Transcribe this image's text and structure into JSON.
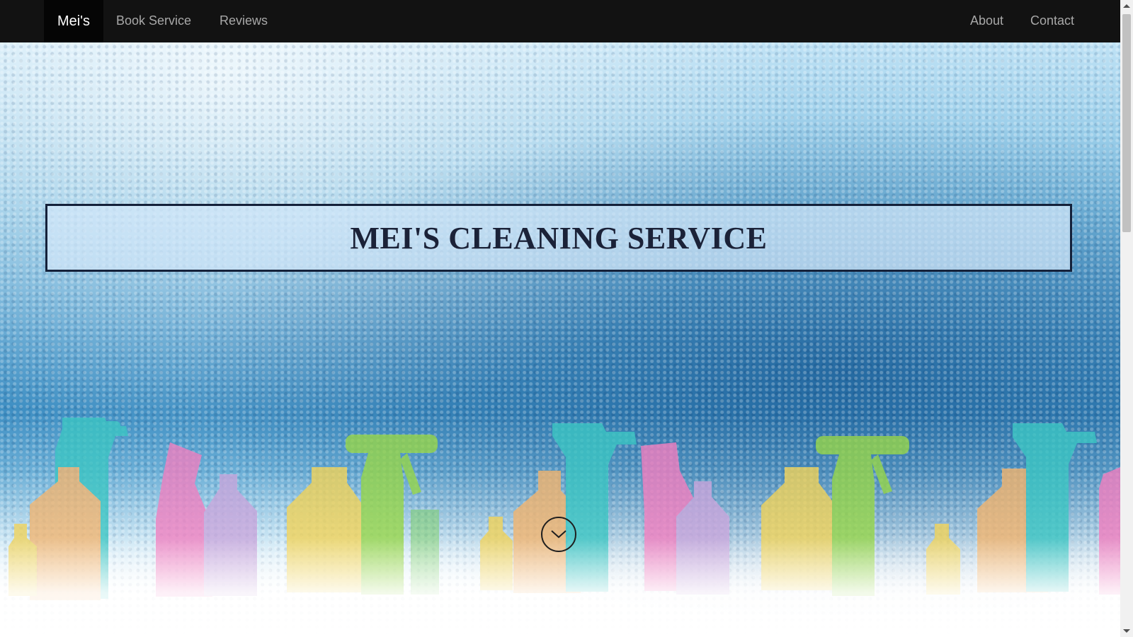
{
  "nav": {
    "brand": "Mei's",
    "left_links": [
      "Book Service",
      "Reviews"
    ],
    "right_links": [
      "About",
      "Contact"
    ]
  },
  "hero": {
    "title": "MEI'S CLEANING SERVICE",
    "scroll_button_icon": "chevron-down-icon"
  },
  "colors": {
    "navbar_bg": "#121212",
    "brand_bg": "#050505",
    "title_border": "#14213a",
    "bottle_teal": "#3cc6c3",
    "bottle_pink": "#f27fc0",
    "bottle_green": "#97d64a",
    "bottle_yellow": "#f1d35a",
    "bottle_orange": "#f3b56f",
    "bottle_lavender": "#c9a6dc"
  }
}
